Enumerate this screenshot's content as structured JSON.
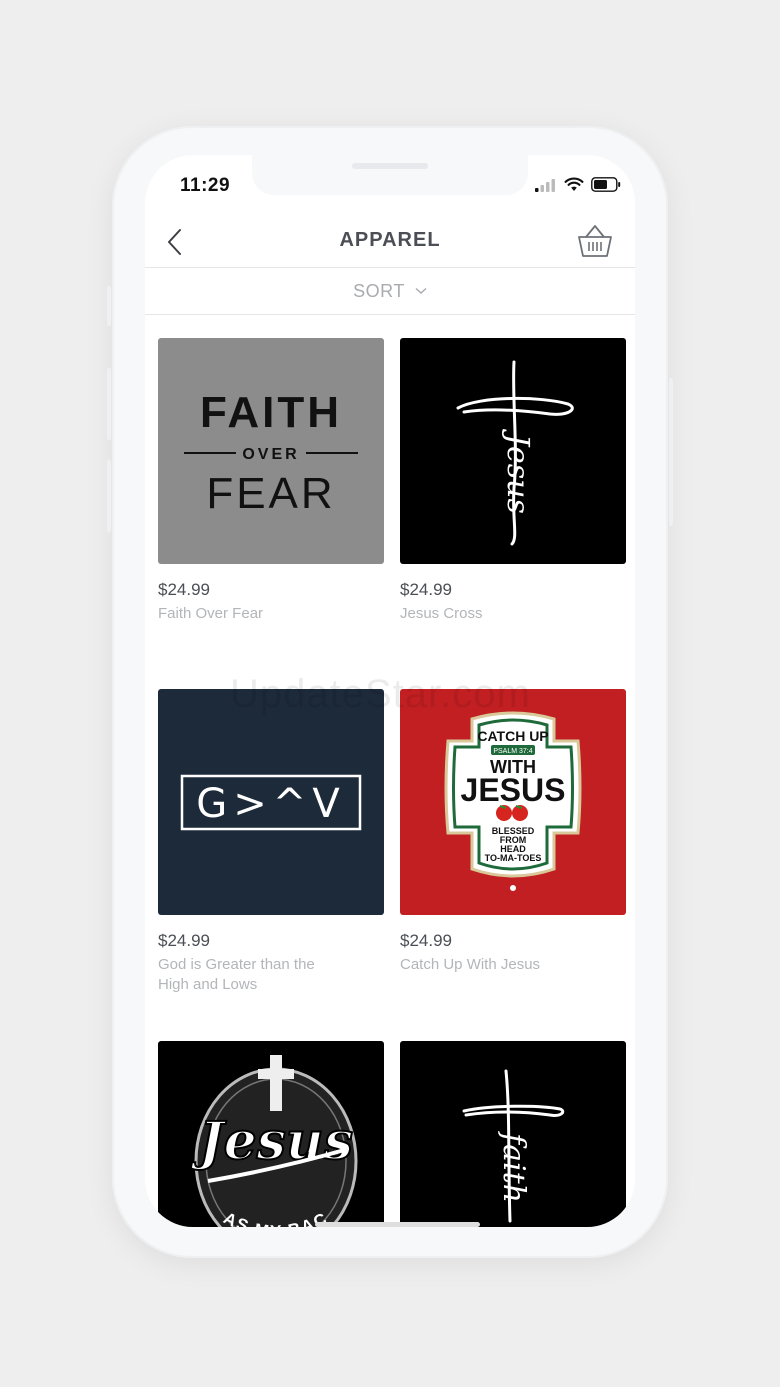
{
  "status": {
    "time": "11:29"
  },
  "header": {
    "title": "APPAREL"
  },
  "sort": {
    "label": "SORT"
  },
  "products": [
    {
      "price": "$24.99",
      "name": "Faith Over Fear",
      "art": {
        "line1": "FAITH",
        "line2": "OVER",
        "line3": "FEAR"
      }
    },
    {
      "price": "$24.99",
      "name": "Jesus Cross",
      "art": {
        "word": "Jesus"
      }
    },
    {
      "price": "$24.99",
      "name": "God is Greater than the High and Lows",
      "art": {
        "symbol": "G>^V"
      }
    },
    {
      "price": "$24.99",
      "name": "Catch Up With Jesus",
      "art": {
        "top": "CATCH UP",
        "ref": "PSALM 37:4",
        "mid1": "WITH",
        "mid2": "JESUS",
        "b1": "BLESSED",
        "b2": "FROM",
        "b3": "HEAD",
        "b4": "TO-MA-TOES"
      }
    },
    {
      "price": "",
      "name": "",
      "art": {
        "word": "Jesus",
        "sub": "HAS MY BACK"
      }
    },
    {
      "price": "",
      "name": "",
      "art": {
        "word": "faith"
      }
    }
  ],
  "watermark": "UpdateStar.com",
  "colors": {
    "gray_tile": "#8c8c8c",
    "navy_tile": "#1d2a3a",
    "red_tile": "#c11f22",
    "black_tile": "#000000"
  }
}
